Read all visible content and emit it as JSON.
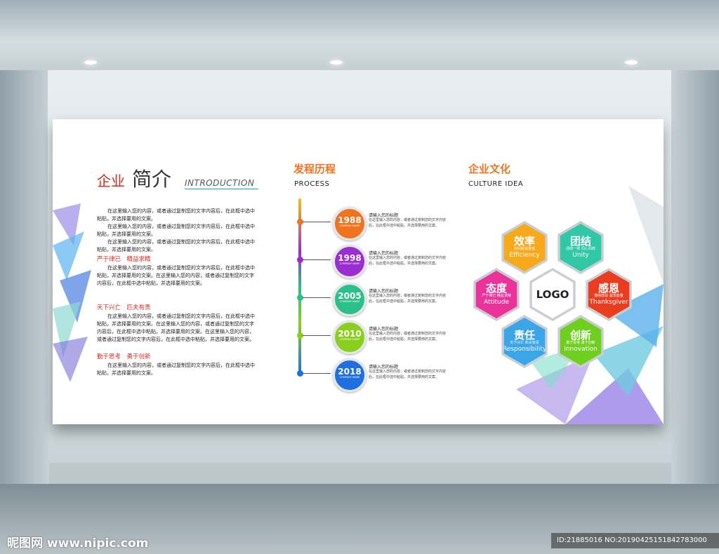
{
  "intro": {
    "title_red": "企业",
    "title_dark": "简介",
    "title_en": "INTRODUCTION",
    "paragraphs": [
      "在这里输入您的内容，或者通过复制您的文字内容后，在此框中选中粘贴，并选择要用的文案。",
      "在这里输入您的内容，或者通过复制您的文字内容后，在此框中选中粘贴，并选择要用的文案。",
      "在这里输入您的内容，或者通过复制您的文字内容后，在此框中选中粘贴，并选择要用的文案。"
    ],
    "sub1": "严于律已　精益求精",
    "para2": "在这里输入您的内容，或者通过复制您的文字内容后，在此框中选中粘贴，并选择要用的文案。在这里输入您的内容，或者通过复制您的文字内容后，在此框中选中粘贴，并选择要用的文案。",
    "sub2": "天下兴亡　匹夫有责",
    "para3": "在这里输入您的内容，或者通过复制您的文字内容后，在此框中选中粘贴，并选择要用的文案。在这里输入您的内容，或者通过复制您的文字内容后，在此框中选中粘贴，并选择要用的文案。在这里输入您的内容，或者通过复制您的文字内容后，在此框中选中粘贴，并选择要用的文案。",
    "sub3": "勤于思考　勇于创新",
    "para4": "在这里输入您的内容，或者通过复制您的文字内容后，在此框中选中粘贴，并选择要用的文案。"
  },
  "process": {
    "title": "发程历程",
    "subtitle": "PROCESS",
    "items": [
      {
        "year": "1988",
        "small": "COMPANY NAME",
        "head": "请输入您的标题",
        "body": "在这里输入您的内容，或者通过复制您的文字内容后，在此框中选中粘贴，并选择要用的文案。",
        "color": "#f0741f"
      },
      {
        "year": "1998",
        "small": "COMPANY NAME",
        "head": "请输入您的标题",
        "body": "在这里输入您的内容，或者通过复制您的文字内容后，在此框中选中粘贴，并选择要用的文案。",
        "color": "#9b2ed1"
      },
      {
        "year": "2005",
        "small": "COMPANY NAME",
        "head": "请输入您的标题",
        "body": "在这里输入您的内容，或者通过复制您的文字内容后，在此框中选中粘贴，并选择要用的文案。",
        "color": "#2bbf8a"
      },
      {
        "year": "2010",
        "small": "COMPANY NAME",
        "head": "请输入您的标题",
        "body": "在这里输入您的内容，或者通过复制您的文字内容后，在此框中选中粘贴，并选择要用的文案。",
        "color": "#8bcf1e"
      },
      {
        "year": "2018",
        "small": "COMPANY NAME",
        "head": "请输入您的标题",
        "body": "在这里输入您的内容，或者通过复制您的文字内容后，在此框中选中粘贴，并选择要用的文案。",
        "color": "#1f6fe0"
      }
    ]
  },
  "culture": {
    "title": "企业文化",
    "subtitle": "CULTURE  IDEA",
    "logo": "LOGO",
    "hexes": [
      {
        "title": "效率",
        "small": "时间就是金钱",
        "en": "Efficiency",
        "color": "#f7a81b"
      },
      {
        "title": "团结",
        "small": "团结一致 同心同德",
        "en": "Unity",
        "color": "#2fc7a5"
      },
      {
        "title": "态度",
        "small": "严于律已 精益求精",
        "en": "Attitude",
        "color": "#e9339b"
      },
      {
        "title": "感恩",
        "small": "懂得感恩 激发能量",
        "en": "Thanksgiver",
        "color": "#ea3c1f"
      },
      {
        "title": "责任",
        "small": "天下兴亡 匹夫有责",
        "en": "Responsibility",
        "color": "#3aa6e8"
      },
      {
        "title": "创新",
        "small": "勇于思考 勇于创新",
        "en": "Innovation",
        "color": "#6fcf1f"
      }
    ]
  },
  "watermark": {
    "left": "昵图网 www.nipic.com",
    "right": "ID:21885016 NO:20190425151842783000"
  }
}
